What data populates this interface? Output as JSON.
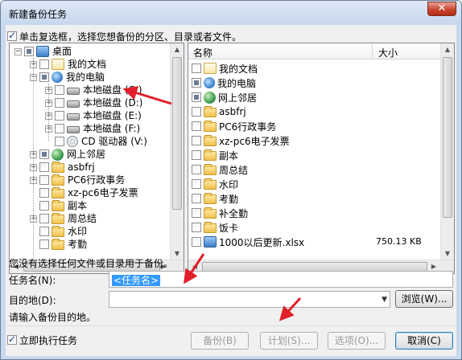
{
  "window": {
    "title": "新建备份任务",
    "close_glyph": "✕"
  },
  "top_check": {
    "label": "单击复选框，选择您想备份的分区、目录或者文件。",
    "checked": true
  },
  "tree": {
    "items": [
      {
        "label": "桌面",
        "level": 0,
        "expander": "minus",
        "icon": "desktop-icon",
        "check": "partial"
      },
      {
        "label": "我的文档",
        "level": 1,
        "expander": "plus",
        "icon": "documents-icon",
        "check": "none"
      },
      {
        "label": "我的电脑",
        "level": 1,
        "expander": "minus",
        "icon": "computer-icon",
        "check": "partial"
      },
      {
        "label": "本地磁盘 (C:)",
        "level": 2,
        "expander": "plus",
        "icon": "drive-icon",
        "check": "none"
      },
      {
        "label": "本地磁盘 (D:)",
        "level": 2,
        "expander": "plus",
        "icon": "drive-icon",
        "check": "none"
      },
      {
        "label": "本地磁盘 (E:)",
        "level": 2,
        "expander": "plus",
        "icon": "drive-icon",
        "check": "none"
      },
      {
        "label": "本地磁盘 (F:)",
        "level": 2,
        "expander": "plus",
        "icon": "drive-icon",
        "check": "none"
      },
      {
        "label": "CD 驱动器 (V:)",
        "level": 2,
        "expander": "none",
        "icon": "cd-drive-icon",
        "check": "none"
      },
      {
        "label": "网上邻居",
        "level": 1,
        "expander": "plus",
        "icon": "network-icon",
        "check": "partial"
      },
      {
        "label": "asbfrj",
        "level": 1,
        "expander": "plus",
        "icon": "folder-icon",
        "check": "none"
      },
      {
        "label": "PC6行政事务",
        "level": 1,
        "expander": "plus",
        "icon": "folder-icon",
        "check": "none"
      },
      {
        "label": "xz-pc6电子发票",
        "level": 1,
        "expander": "none",
        "icon": "folder-icon",
        "check": "none"
      },
      {
        "label": "副本",
        "level": 1,
        "expander": "none",
        "icon": "folder-icon",
        "check": "none"
      },
      {
        "label": "周总结",
        "level": 1,
        "expander": "plus",
        "icon": "folder-icon",
        "check": "none"
      },
      {
        "label": "水印",
        "level": 1,
        "expander": "none",
        "icon": "folder-icon",
        "check": "none"
      },
      {
        "label": "考勤",
        "level": 1,
        "expander": "none",
        "icon": "folder-icon",
        "check": "none"
      }
    ]
  },
  "list": {
    "col_name": "名称",
    "col_size": "大小",
    "rows": [
      {
        "name": "我的文档",
        "icon": "documents-icon",
        "check": "none",
        "size": ""
      },
      {
        "name": "我的电脑",
        "icon": "computer-icon",
        "check": "partial",
        "size": ""
      },
      {
        "name": "网上邻居",
        "icon": "network-icon",
        "check": "partial",
        "size": ""
      },
      {
        "name": "asbfrj",
        "icon": "folder-icon",
        "check": "none",
        "size": ""
      },
      {
        "name": "PC6行政事务",
        "icon": "folder-icon",
        "check": "none",
        "size": ""
      },
      {
        "name": "xz-pc6电子发票",
        "icon": "folder-icon",
        "check": "none",
        "size": ""
      },
      {
        "name": "副本",
        "icon": "folder-icon",
        "check": "none",
        "size": ""
      },
      {
        "name": "周总结",
        "icon": "folder-icon",
        "check": "none",
        "size": ""
      },
      {
        "name": "水印",
        "icon": "folder-icon",
        "check": "none",
        "size": ""
      },
      {
        "name": "考勤",
        "icon": "folder-icon",
        "check": "none",
        "size": ""
      },
      {
        "name": "补全勤",
        "icon": "folder-icon",
        "check": "none",
        "size": ""
      },
      {
        "name": "饭卡",
        "icon": "folder-icon",
        "check": "none",
        "size": ""
      },
      {
        "name": "1000以后更新.xlsx",
        "icon": "excel-file-icon",
        "check": "none",
        "size": "750.13 KB"
      }
    ]
  },
  "status_message": "您没有选择任何文件或目录用于备份。",
  "task_name": {
    "label": "任务名(N):",
    "value": "<任务名>"
  },
  "destination": {
    "label": "目的地(D):",
    "value": "",
    "browse_label": "浏览(W)..."
  },
  "dest_hint": "请输入备份目的地。",
  "run_now": {
    "label": "立即执行任务",
    "checked": true
  },
  "buttons": {
    "backup": "备份(B)",
    "schedule": "计划(S)...",
    "options": "选项(O)...",
    "cancel": "取消(C)"
  },
  "colors": {
    "annotation_arrow": "#e0202a",
    "selection": "#3399ff"
  }
}
